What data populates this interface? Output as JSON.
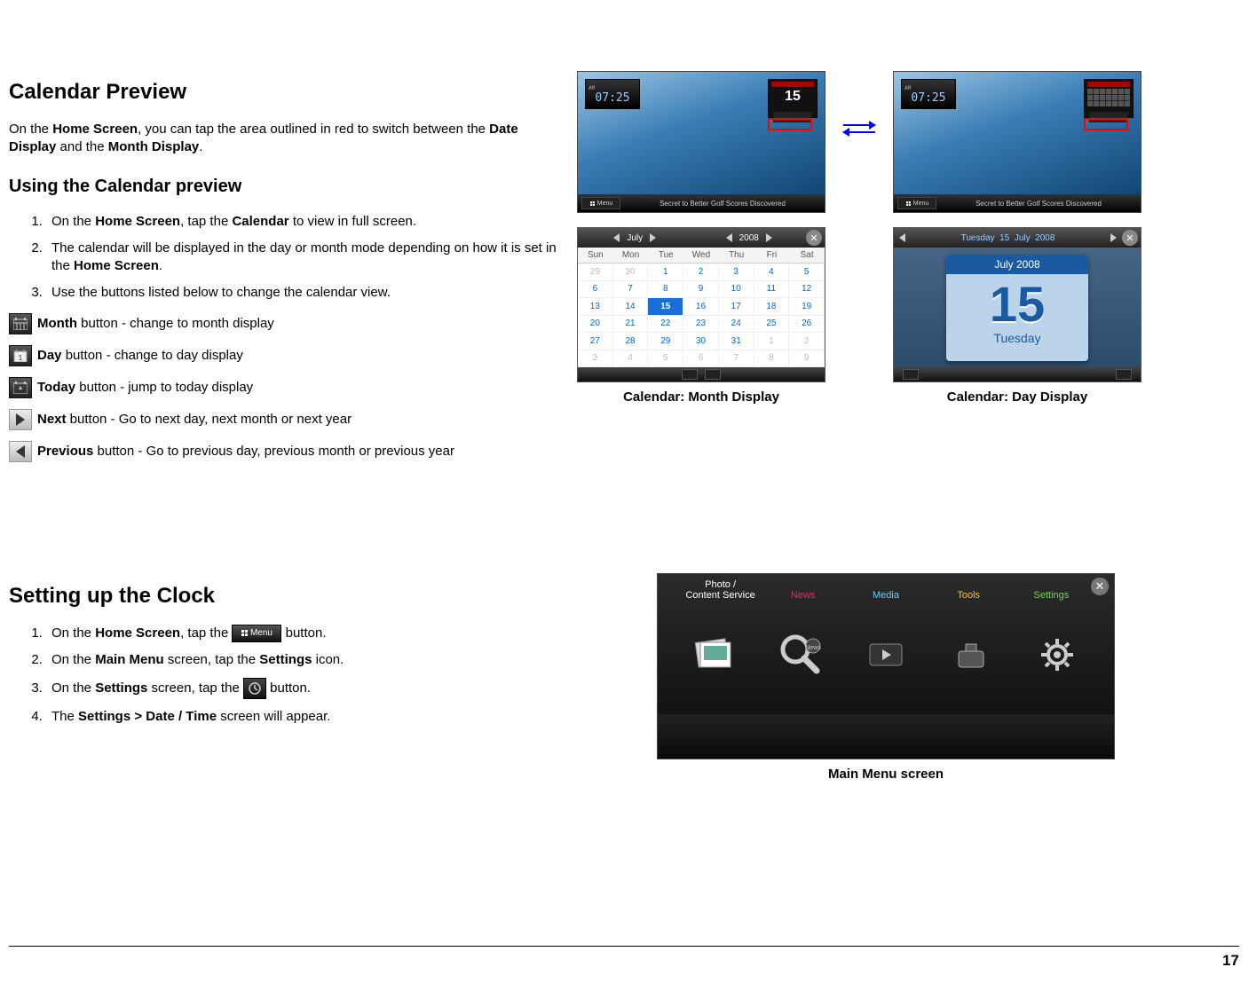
{
  "page_number": "17",
  "section1": {
    "title": "Calendar Preview",
    "intro_pre": "On the ",
    "intro_b1": "Home Screen",
    "intro_mid1": ", you can tap the area outlined in red to switch between the ",
    "intro_b2": "Date Display",
    "intro_mid2": " and the ",
    "intro_b3": "Month Display",
    "intro_end": "."
  },
  "section1b": {
    "title": "Using the Calendar preview",
    "step1_a": "On the ",
    "step1_b1": "Home Screen",
    "step1_b": ", tap the ",
    "step1_b2": "Calendar",
    "step1_c": " to view in full screen.",
    "step2_a": "The calendar will be displayed in the day or month mode depending on how it is set in the ",
    "step2_b1": "Home Screen",
    "step2_b": ".",
    "step3": "Use the buttons listed below to change the calendar view.",
    "btn_month_b": "Month",
    "btn_month_t": " button - change to month display",
    "btn_day_b": "Day",
    "btn_day_t": " button - change to day display",
    "btn_today_b": "Today",
    "btn_today_t": " button - jump to today display",
    "btn_next_b": "Next",
    "btn_next_t": " button - Go to next day, next month or next year",
    "btn_prev_b": "Previous",
    "btn_prev_t": " button - Go to previous day, previous month or previous year"
  },
  "section2": {
    "title": "Setting up the Clock",
    "s1_a": "On the ",
    "s1_b1": "Home Screen",
    "s1_b": ", tap the ",
    "s1_c": " button.",
    "s2_a": "On the ",
    "s2_b1": "Main Menu",
    "s2_b": " screen, tap the ",
    "s2_b2": "Settings",
    "s2_c": " icon.",
    "s3_a": "On the ",
    "s3_b1": "Settings",
    "s3_b": " screen, tap the ",
    "s3_c": " button.",
    "s4_a": "The ",
    "s4_b1": "Settings > Date / Time",
    "s4_b": " screen will appear."
  },
  "figs": {
    "home_clock_time": "07:25",
    "home_clock_ampm": "AM",
    "home_cal_day": "15",
    "home_ticker": "Secret to Better Golf Scores Discovered",
    "home_menu": "Menu",
    "cal_month_caption": "Calendar: Month Display",
    "cal_day_caption": "Calendar: Day Display",
    "mainmenu_caption": "Main Menu screen",
    "month_nav_month": "July",
    "month_nav_year": "2008",
    "dow": [
      "Sun",
      "Mon",
      "Tue",
      "Wed",
      "Thu",
      "Fri",
      "Sat"
    ],
    "month_cells": [
      {
        "v": "29",
        "dim": true
      },
      {
        "v": "30",
        "dim": true
      },
      {
        "v": "1"
      },
      {
        "v": "2"
      },
      {
        "v": "3"
      },
      {
        "v": "4"
      },
      {
        "v": "5"
      },
      {
        "v": "6"
      },
      {
        "v": "7"
      },
      {
        "v": "8"
      },
      {
        "v": "9"
      },
      {
        "v": "10"
      },
      {
        "v": "11"
      },
      {
        "v": "12"
      },
      {
        "v": "13"
      },
      {
        "v": "14"
      },
      {
        "v": "15",
        "sel": true
      },
      {
        "v": "16"
      },
      {
        "v": "17"
      },
      {
        "v": "18"
      },
      {
        "v": "19"
      },
      {
        "v": "20"
      },
      {
        "v": "21"
      },
      {
        "v": "22"
      },
      {
        "v": "23"
      },
      {
        "v": "24"
      },
      {
        "v": "25"
      },
      {
        "v": "26"
      },
      {
        "v": "27"
      },
      {
        "v": "28"
      },
      {
        "v": "29"
      },
      {
        "v": "30"
      },
      {
        "v": "31"
      },
      {
        "v": "1",
        "dim": true
      },
      {
        "v": "2",
        "dim": true
      },
      {
        "v": "3",
        "dim": true
      },
      {
        "v": "4",
        "dim": true
      },
      {
        "v": "5",
        "dim": true
      },
      {
        "v": "6",
        "dim": true
      },
      {
        "v": "7",
        "dim": true
      },
      {
        "v": "8",
        "dim": true
      },
      {
        "v": "9",
        "dim": true
      }
    ],
    "day_top_weekday": "Tuesday",
    "day_top_day": "15",
    "day_top_month": "July",
    "day_top_year": "2008",
    "day_page_header": "July 2008",
    "day_page_num": "15",
    "day_page_name": "Tuesday",
    "mm_tabs": [
      {
        "label": "Photo /\nContent Service",
        "color": "#fff"
      },
      {
        "label": "News",
        "color": "#d36"
      },
      {
        "label": "Media",
        "color": "#6cf"
      },
      {
        "label": "Tools",
        "color": "#fb3"
      },
      {
        "label": "Settings",
        "color": "#6d4"
      }
    ],
    "menu_label": "Menu"
  }
}
